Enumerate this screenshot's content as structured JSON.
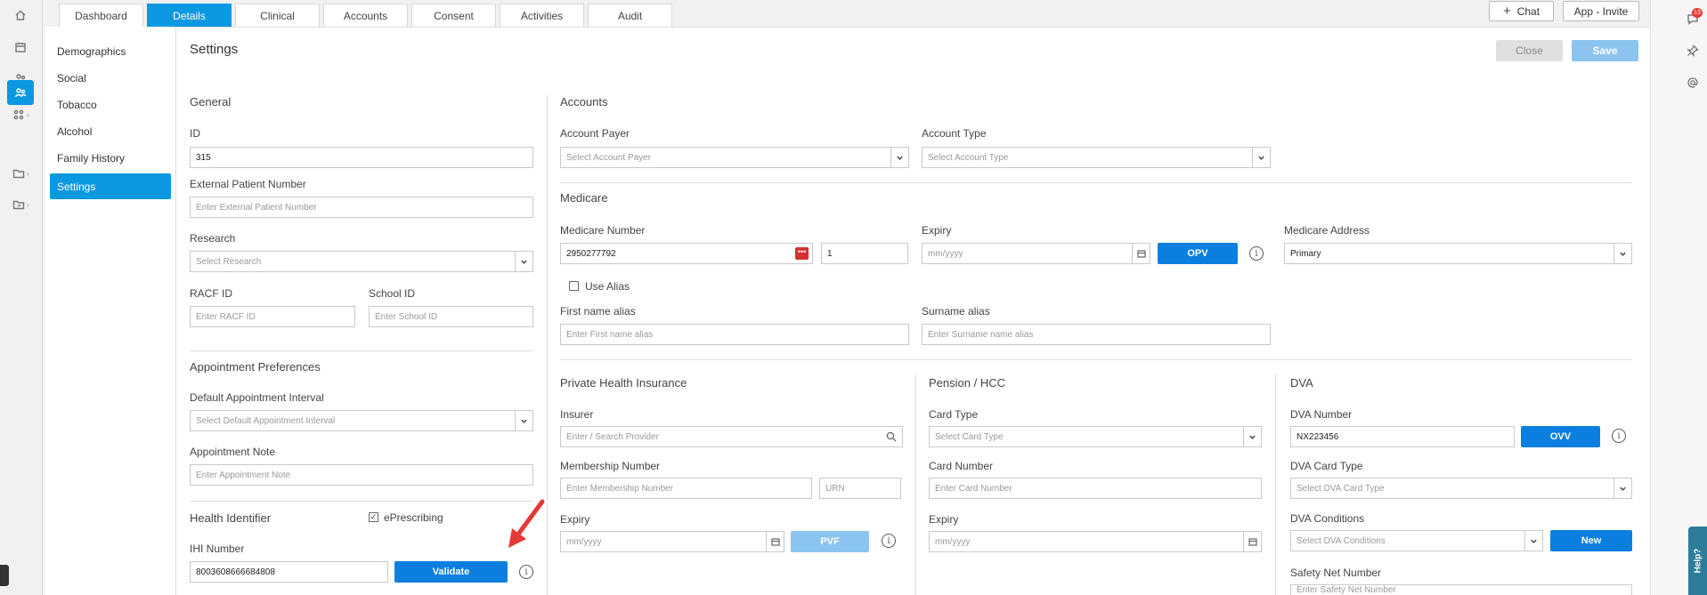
{
  "nav": {
    "icons": [
      "home-icon",
      "calendar-icon",
      "people-icon",
      "patient-icon",
      "groups-icon",
      "folder-icon",
      "folder-share-icon"
    ]
  },
  "tabs": [
    "Dashboard",
    "Details",
    "Clinical",
    "Accounts",
    "Consent",
    "Activities",
    "Audit"
  ],
  "active_tab": "Details",
  "top_buttons": {
    "chat_label": "Chat",
    "invite_label": "App - Invite"
  },
  "sidebar": {
    "items": [
      "Demographics",
      "Social",
      "Tobacco",
      "Alcohol",
      "Family History",
      "Settings"
    ],
    "active": "Settings"
  },
  "page": {
    "title": "Settings",
    "close_label": "Close",
    "save_label": "Save"
  },
  "general": {
    "title": "General",
    "id_label": "ID",
    "id_value": "315",
    "ext_label": "External Patient Number",
    "ext_placeholder": "Enter External Patient Number",
    "research_label": "Research",
    "research_placeholder": "Select Research",
    "racf_label": "RACF ID",
    "racf_placeholder": "Enter RACF ID",
    "school_label": "School ID",
    "school_placeholder": "Enter School ID"
  },
  "appointment": {
    "title": "Appointment Preferences",
    "interval_label": "Default Appointment Interval",
    "interval_placeholder": "Select Default Appointment Interval",
    "note_label": "Appointment Note",
    "note_placeholder": "Enter Appointment Note"
  },
  "health": {
    "title": "Health Identifier",
    "eprescribing_label": "ePrescribing",
    "eprescribing_checked": true,
    "ihi_label": "IHI Number",
    "ihi_value": "8003608666684808",
    "validate_label": "Validate"
  },
  "accounts": {
    "title": "Accounts",
    "payer_label": "Account Payer",
    "payer_placeholder": "Select Account Payer",
    "type_label": "Account Type",
    "type_placeholder": "Select Account Type"
  },
  "medicare": {
    "title": "Medicare",
    "number_label": "Medicare Number",
    "number_value": "2950277792",
    "irn_value": "1",
    "expiry_label": "Expiry",
    "expiry_placeholder": "mm/yyyy",
    "opv_label": "OPV",
    "address_label": "Medicare Address",
    "address_value": "Primary",
    "alias_label": "Use Alias",
    "first_alias_label": "First name alias",
    "first_alias_placeholder": "Enter First name alias",
    "surname_alias_label": "Surname alias",
    "surname_alias_placeholder": "Enter Surname name alias"
  },
  "phi": {
    "title": "Private Health Insurance",
    "insurer_label": "Insurer",
    "insurer_placeholder": "Enter / Search Provider",
    "membership_label": "Membership Number",
    "membership_placeholder": "Enter Membership Number",
    "urn_placeholder": "URN",
    "expiry_label": "Expiry",
    "expiry_placeholder": "mm/yyyy",
    "pvf_label": "PVF"
  },
  "pension": {
    "title": "Pension / HCC",
    "card_type_label": "Card Type",
    "card_type_placeholder": "Select Card Type",
    "card_number_label": "Card Number",
    "card_number_placeholder": "Enter Card Number",
    "expiry_label": "Expiry",
    "expiry_placeholder": "mm/yyyy"
  },
  "dva": {
    "title": "DVA",
    "number_label": "DVA Number",
    "number_value": "NX223456",
    "ovv_label": "OVV",
    "card_type_label": "DVA Card Type",
    "card_type_placeholder": "Select DVA Card Type",
    "conditions_label": "DVA Conditions",
    "conditions_placeholder": "Select DVA Conditions",
    "new_label": "New",
    "safety_label": "Safety Net Number",
    "safety_placeholder": "Enter Safety Net Number"
  },
  "right_rail": {
    "badge_count": "13",
    "help_label": "Help?"
  },
  "colors": {
    "accent": "#0a99e0",
    "button_blue": "#0a7fe0",
    "arrow_red": "#e53935"
  }
}
